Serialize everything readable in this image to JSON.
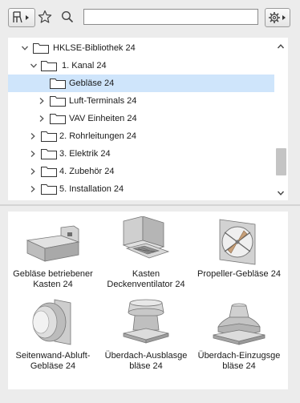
{
  "toolbar": {
    "mode_icon": "library-mode-icon",
    "favorites_icon": "star-icon",
    "search_icon": "search-icon",
    "search": {
      "value": "",
      "placeholder": ""
    },
    "settings_icon": "gear-icon"
  },
  "tree": {
    "items": [
      {
        "label": "HKLSE-Bibliothek 24",
        "expanded": true,
        "selected": false
      },
      {
        "label": "1. Kanal 24",
        "expanded": true,
        "selected": false
      },
      {
        "label": "Gebläse 24",
        "expanded": false,
        "selected": true
      },
      {
        "label": "Luft-Terminals 24",
        "expanded": false,
        "selected": false
      },
      {
        "label": "VAV Einheiten 24",
        "expanded": false,
        "selected": false
      },
      {
        "label": "2. Rohrleitungen 24",
        "expanded": false,
        "selected": false
      },
      {
        "label": "3. Elektrik 24",
        "expanded": false,
        "selected": false
      },
      {
        "label": "4. Zubehör 24",
        "expanded": false,
        "selected": false
      },
      {
        "label": "5. Installation 24",
        "expanded": false,
        "selected": false
      }
    ]
  },
  "grid": {
    "items": [
      {
        "line1": "Gebläse betriebener",
        "line2": "Kasten 24"
      },
      {
        "line1": "Kasten",
        "line2": "Deckenventilator 24"
      },
      {
        "line1": "Propeller-Gebläse 24",
        "line2": ""
      },
      {
        "line1": "Seitenwand-Abluft-",
        "line2": "Gebläse 24"
      },
      {
        "line1": "Überdach-Ausblasge",
        "line2": "bläse 24"
      },
      {
        "line1": "Überdach-Einzugsge",
        "line2": "bläse 24"
      }
    ]
  },
  "colors": {
    "selection": "#cfe5fb",
    "panel_bg": "#ffffff",
    "window_bg": "#ececec"
  }
}
